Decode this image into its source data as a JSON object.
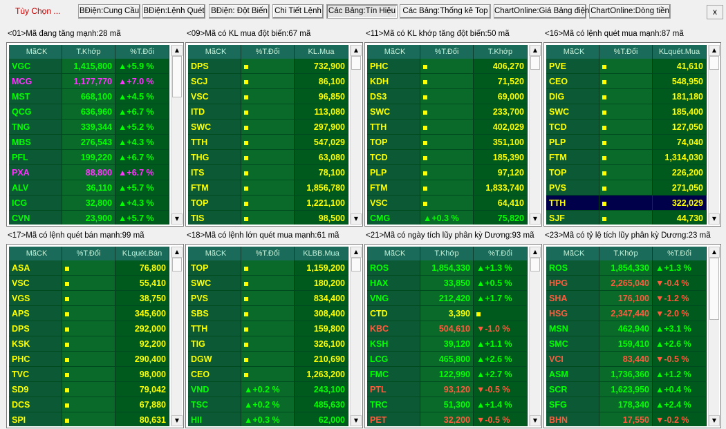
{
  "toolbar": {
    "menu_label": "Tùy Chọn ...",
    "buttons": [
      "BĐiện:Cung Cầu",
      "BĐiện:Lệnh Quét",
      "BĐiện: Đột Biến",
      "Chi Tiết Lệnh",
      "Các Bảng:Tín Hiệu",
      "Các Bảng:Thống kê Top",
      "ChartOnline:Giá Bảng điện",
      "ChartOnline:Dòng tiền"
    ],
    "active_button": "Các Bảng:Tín Hiệu",
    "close_label": "x"
  },
  "colors": {
    "green": "#00ff00",
    "yellow": "#ffff00",
    "red": "#ff5a3c",
    "magenta": "#ff33ff",
    "white": "#ffffff",
    "rowA": "#006400",
    "rowB": "#004d2a",
    "rowHighlight": "#00004a"
  },
  "panels": [
    {
      "title": "<01>Mã đang tăng mạnh:28 mã",
      "headers": [
        "MãCK",
        "T.Khớp",
        "%T.Đổi"
      ],
      "rows": [
        {
          "symbol": "VGC",
          "col1": "1,415,800",
          "col2": "▲+5.9 %",
          "color": "green"
        },
        {
          "symbol": "MCG",
          "col1": "1,177,770",
          "col2": "▲+7.0 %",
          "color": "magenta"
        },
        {
          "symbol": "MST",
          "col1": "668,100",
          "col2": "▲+4.5 %",
          "color": "green"
        },
        {
          "symbol": "QCG",
          "col1": "636,960",
          "col2": "▲+6.7 %",
          "color": "green"
        },
        {
          "symbol": "TNG",
          "col1": "339,344",
          "col2": "▲+5.2 %",
          "color": "green"
        },
        {
          "symbol": "MBS",
          "col1": "276,543",
          "col2": "▲+4.3 %",
          "color": "green"
        },
        {
          "symbol": "PFL",
          "col1": "199,220",
          "col2": "▲+6.7 %",
          "color": "green"
        },
        {
          "symbol": "PXA",
          "col1": "88,800",
          "col2": "▲+6.7 %",
          "color": "magenta"
        },
        {
          "symbol": "ALV",
          "col1": "36,110",
          "col2": "▲+5.7 %",
          "color": "green"
        },
        {
          "symbol": "ICG",
          "col1": "32,800",
          "col2": "▲+4.3 %",
          "color": "green"
        },
        {
          "symbol": "CVN",
          "col1": "23,900",
          "col2": "▲+5.7 %",
          "color": "green"
        }
      ]
    },
    {
      "title": "<09>Mã có KL mua đột biến:67 mã",
      "headers": [
        "MãCK",
        "%T.Đổi",
        "KL.Mua"
      ],
      "rows": [
        {
          "symbol": "DPS",
          "col1": "■",
          "col2": "732,900",
          "color": "yellow"
        },
        {
          "symbol": "SCJ",
          "col1": "■",
          "col2": "86,100",
          "color": "yellow"
        },
        {
          "symbol": "VSC",
          "col1": "■",
          "col2": "96,850",
          "color": "yellow"
        },
        {
          "symbol": "ITD",
          "col1": "■",
          "col2": "113,080",
          "color": "yellow"
        },
        {
          "symbol": "SWC",
          "col1": "■",
          "col2": "297,900",
          "color": "yellow"
        },
        {
          "symbol": "TTH",
          "col1": "■",
          "col2": "547,029",
          "color": "yellow"
        },
        {
          "symbol": "THG",
          "col1": "■",
          "col2": "63,080",
          "color": "yellow"
        },
        {
          "symbol": "ITS",
          "col1": "■",
          "col2": "78,100",
          "color": "yellow"
        },
        {
          "symbol": "FTM",
          "col1": "■",
          "col2": "1,856,780",
          "color": "yellow"
        },
        {
          "symbol": "TOP",
          "col1": "■",
          "col2": "1,221,100",
          "color": "yellow"
        },
        {
          "symbol": "TIS",
          "col1": "■",
          "col2": "98,500",
          "color": "yellow"
        }
      ]
    },
    {
      "title": "<11>Mã có KL khớp tăng đột biến:50 mã",
      "headers": [
        "MãCK",
        "%T.Đổi",
        "T.Khớp"
      ],
      "rows": [
        {
          "symbol": "PHC",
          "col1": "■",
          "col2": "406,270",
          "color": "yellow"
        },
        {
          "symbol": "KDH",
          "col1": "■",
          "col2": "71,520",
          "color": "yellow"
        },
        {
          "symbol": "DS3",
          "col1": "■",
          "col2": "69,000",
          "color": "yellow"
        },
        {
          "symbol": "SWC",
          "col1": "■",
          "col2": "233,700",
          "color": "yellow"
        },
        {
          "symbol": "TTH",
          "col1": "■",
          "col2": "402,029",
          "color": "yellow"
        },
        {
          "symbol": "TOP",
          "col1": "■",
          "col2": "351,100",
          "color": "yellow"
        },
        {
          "symbol": "TCD",
          "col1": "■",
          "col2": "185,390",
          "color": "yellow"
        },
        {
          "symbol": "PLP",
          "col1": "■",
          "col2": "97,120",
          "color": "yellow"
        },
        {
          "symbol": "FTM",
          "col1": "■",
          "col2": "1,833,740",
          "color": "yellow"
        },
        {
          "symbol": "VSC",
          "col1": "■",
          "col2": "64,410",
          "color": "yellow"
        },
        {
          "symbol": "CMG",
          "col1": "▲+0.3 %",
          "col2": "75,820",
          "color": "green"
        }
      ]
    },
    {
      "title": "<16>Mã có lệnh quét mua mạnh:87 mã",
      "headers": [
        "MãCK",
        "%T.Đổi",
        "KLquét.Mua"
      ],
      "rows": [
        {
          "symbol": "PVE",
          "col1": "■",
          "col2": "41,610",
          "color": "yellow"
        },
        {
          "symbol": "CEO",
          "col1": "■",
          "col2": "548,950",
          "color": "yellow"
        },
        {
          "symbol": "DIG",
          "col1": "■",
          "col2": "181,180",
          "color": "yellow"
        },
        {
          "symbol": "SWC",
          "col1": "■",
          "col2": "185,400",
          "color": "yellow"
        },
        {
          "symbol": "TCD",
          "col1": "■",
          "col2": "127,050",
          "color": "yellow"
        },
        {
          "symbol": "PLP",
          "col1": "■",
          "col2": "74,040",
          "color": "yellow"
        },
        {
          "symbol": "FTM",
          "col1": "■",
          "col2": "1,314,030",
          "color": "yellow"
        },
        {
          "symbol": "TOP",
          "col1": "■",
          "col2": "226,200",
          "color": "yellow"
        },
        {
          "symbol": "PVS",
          "col1": "■",
          "col2": "271,050",
          "color": "yellow"
        },
        {
          "symbol": "TTH",
          "col1": "■",
          "col2": "322,029",
          "color": "yellow",
          "highlight": true
        },
        {
          "symbol": "SJF",
          "col1": "■",
          "col2": "44,730",
          "color": "yellow"
        }
      ]
    },
    {
      "title": "<17>Mã có lệnh quét bán mạnh:99 mã",
      "headers": [
        "MãCK",
        "%T.Đổi",
        "KLquét.Bán"
      ],
      "rows": [
        {
          "symbol": "ASA",
          "col1": "■",
          "col2": "76,800",
          "color": "yellow"
        },
        {
          "symbol": "VSC",
          "col1": "■",
          "col2": "55,410",
          "color": "yellow"
        },
        {
          "symbol": "VGS",
          "col1": "■",
          "col2": "38,750",
          "color": "yellow"
        },
        {
          "symbol": "APS",
          "col1": "■",
          "col2": "345,600",
          "color": "yellow"
        },
        {
          "symbol": "DPS",
          "col1": "■",
          "col2": "292,000",
          "color": "yellow"
        },
        {
          "symbol": "KSK",
          "col1": "■",
          "col2": "92,200",
          "color": "yellow"
        },
        {
          "symbol": "PHC",
          "col1": "■",
          "col2": "290,400",
          "color": "yellow"
        },
        {
          "symbol": "TVC",
          "col1": "■",
          "col2": "98,000",
          "color": "yellow"
        },
        {
          "symbol": "SD9",
          "col1": "■",
          "col2": "79,042",
          "color": "yellow"
        },
        {
          "symbol": "DCS",
          "col1": "■",
          "col2": "67,880",
          "color": "yellow"
        },
        {
          "symbol": "SPI",
          "col1": "■",
          "col2": "80,631",
          "color": "yellow"
        }
      ]
    },
    {
      "title": "<18>Mã có lệnh lớn quét mua mạnh:61 mã",
      "headers": [
        "MãCK",
        "%T.Đổi",
        "KLBB.Mua"
      ],
      "rows": [
        {
          "symbol": "TOP",
          "col1": "■",
          "col2": "1,159,200",
          "color": "yellow"
        },
        {
          "symbol": "SWC",
          "col1": "■",
          "col2": "180,200",
          "color": "yellow"
        },
        {
          "symbol": "PVS",
          "col1": "■",
          "col2": "834,400",
          "color": "yellow"
        },
        {
          "symbol": "SBS",
          "col1": "■",
          "col2": "308,400",
          "color": "yellow"
        },
        {
          "symbol": "TTH",
          "col1": "■",
          "col2": "159,800",
          "color": "yellow"
        },
        {
          "symbol": "TIG",
          "col1": "■",
          "col2": "326,100",
          "color": "yellow"
        },
        {
          "symbol": "DGW",
          "col1": "■",
          "col2": "210,690",
          "color": "yellow"
        },
        {
          "symbol": "CEO",
          "col1": "■",
          "col2": "1,263,200",
          "color": "yellow"
        },
        {
          "symbol": "VND",
          "col1": "▲+0.2 %",
          "col2": "243,100",
          "color": "green"
        },
        {
          "symbol": "TSC",
          "col1": "▲+0.2 %",
          "col2": "485,630",
          "color": "green"
        },
        {
          "symbol": "HII",
          "col1": "▲+0.3 %",
          "col2": "62,000",
          "color": "green"
        }
      ]
    },
    {
      "title": "<21>Mã có ngày tích lũy phân kỳ Dương:93 mã",
      "headers": [
        "MãCK",
        "T.Khớp",
        "%T.Đổi"
      ],
      "rows": [
        {
          "symbol": "ROS",
          "col1": "1,854,330",
          "col2": "▲+1.3 %",
          "color": "green"
        },
        {
          "symbol": "HAX",
          "col1": "33,850",
          "col2": "▲+0.5 %",
          "color": "green"
        },
        {
          "symbol": "VNG",
          "col1": "212,420",
          "col2": "▲+1.7 %",
          "color": "green"
        },
        {
          "symbol": "CTD",
          "col1": "3,390",
          "col2": "■",
          "color": "yellow"
        },
        {
          "symbol": "KBC",
          "col1": "504,610",
          "col2": "▼-1.0 %",
          "color": "red"
        },
        {
          "symbol": "KSH",
          "col1": "39,120",
          "col2": "▲+1.1 %",
          "color": "green"
        },
        {
          "symbol": "LCG",
          "col1": "465,800",
          "col2": "▲+2.6 %",
          "color": "green"
        },
        {
          "symbol": "FMC",
          "col1": "122,990",
          "col2": "▲+2.7 %",
          "color": "green"
        },
        {
          "symbol": "PTL",
          "col1": "93,120",
          "col2": "▼-0.5 %",
          "color": "red"
        },
        {
          "symbol": "TRC",
          "col1": "51,300",
          "col2": "▲+1.4 %",
          "color": "green"
        },
        {
          "symbol": "PET",
          "col1": "32,200",
          "col2": "▼-0.5 %",
          "color": "red"
        }
      ]
    },
    {
      "title": "<23>Mã có tỷ lệ tích lũy phân kỳ Dương:23 mã",
      "headers": [
        "MãCK",
        "T.Khớp",
        "%T.Đổi"
      ],
      "rows": [
        {
          "symbol": "ROS",
          "col1": "1,854,330",
          "col2": "▲+1.3 %",
          "color": "green"
        },
        {
          "symbol": "HPG",
          "col1": "2,265,040",
          "col2": "▼-0.4 %",
          "color": "red"
        },
        {
          "symbol": "SHA",
          "col1": "176,100",
          "col2": "▼-1.2 %",
          "color": "red"
        },
        {
          "symbol": "HSG",
          "col1": "2,347,440",
          "col2": "▼-2.0 %",
          "color": "red"
        },
        {
          "symbol": "MSN",
          "col1": "462,940",
          "col2": "▲+3.1 %",
          "color": "green"
        },
        {
          "symbol": "SMC",
          "col1": "159,410",
          "col2": "▲+2.6 %",
          "color": "green"
        },
        {
          "symbol": "VCI",
          "col1": "83,440",
          "col2": "▼-0.5 %",
          "color": "red"
        },
        {
          "symbol": "ASM",
          "col1": "1,736,360",
          "col2": "▲+1.2 %",
          "color": "green"
        },
        {
          "symbol": "SCR",
          "col1": "1,623,950",
          "col2": "▲+0.4 %",
          "color": "green"
        },
        {
          "symbol": "SFG",
          "col1": "178,340",
          "col2": "▲+2.4 %",
          "color": "green"
        },
        {
          "symbol": "BHN",
          "col1": "17,550",
          "col2": "▼-0.2 %",
          "color": "red"
        }
      ]
    }
  ]
}
